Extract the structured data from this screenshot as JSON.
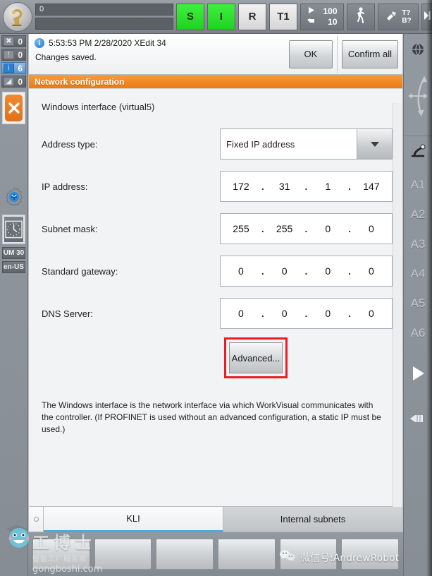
{
  "toolbar": {
    "robot_icon": "robot-arm-icon",
    "field_top_value": "0",
    "field_bottom_value": "",
    "buttons": [
      {
        "label": "S",
        "state": "green"
      },
      {
        "label": "I",
        "state": "green"
      },
      {
        "label": "R",
        "state": "pale"
      },
      {
        "label": "T1",
        "state": "pale"
      }
    ],
    "speed": {
      "program_override": "100",
      "jog_override": "10",
      "play-icon": "play-icon",
      "hand-icon": "jog-hand-icon"
    },
    "walk_icon": "walking-person-icon",
    "tool_base": {
      "tool": "T?",
      "base": "B?",
      "icon": "tool-icon"
    },
    "increment": {
      "icon": "increment-step-icon",
      "label": "∞"
    }
  },
  "left_rail": {
    "counters": [
      {
        "icon": "error-icon",
        "count": "0",
        "active": false
      },
      {
        "icon": "warning-icon",
        "count": "0",
        "active": false
      },
      {
        "icon": "information-icon",
        "count": "6",
        "active": true
      },
      {
        "icon": "note-icon",
        "count": "0",
        "active": false
      }
    ],
    "close_button": "close-x-icon",
    "network_icon": "network-settings-icon",
    "clock_icon": "clock-icon",
    "tags": [
      "UM 30",
      "en-US"
    ]
  },
  "right_rail": {
    "globe_icon": "world-coordinate-icon",
    "motion_icon": "motion-arc-icon",
    "axis_icon": "axis-jog-icon",
    "axes": [
      "A1",
      "A2",
      "A3",
      "A4",
      "A5",
      "A6"
    ],
    "play_icon": "play-triangle-icon",
    "hand_icon": "hand-jog-icon"
  },
  "message": {
    "icon": "information-icon",
    "header": "5:53:53 PM 2/28/2020 XEdit 34",
    "body": "Changes saved.",
    "ok_label": "OK",
    "confirm_all_label": "Confirm all"
  },
  "panel": {
    "title": "Network configuration",
    "interface_title": "Windows interface (virtual5)",
    "fields": [
      {
        "label": "Address type:",
        "type": "combo",
        "value": "Fixed IP address"
      },
      {
        "label": "IP address:",
        "type": "ip",
        "octets": [
          "172",
          "31",
          "1",
          "147"
        ]
      },
      {
        "label": "Subnet mask:",
        "type": "ip",
        "octets": [
          "255",
          "255",
          "0",
          "0"
        ]
      },
      {
        "label": "Standard gateway:",
        "type": "ip",
        "octets": [
          "0",
          "0",
          "0",
          "0"
        ]
      },
      {
        "label": "DNS Server:",
        "type": "ip",
        "octets": [
          "0",
          "0",
          "0",
          "0"
        ]
      }
    ],
    "advanced_label": "Advanced...",
    "advanced_highlight_color": "#ec1c24",
    "help_text": "The Windows interface is the network interface via which WorkVisual communicates with the controller. (If PROFINET is used without an advanced configuration, a static IP must be used.)"
  },
  "tabs": [
    {
      "label": "KLI",
      "active": true
    },
    {
      "label": "Internal subnets",
      "active": false
    }
  ],
  "bottom_buttons": [
    "",
    "",
    "",
    "",
    "",
    ""
  ],
  "watermarks": {
    "gongboshi_cn": "工博士",
    "gongboshi_sub": "智能工厂服务商",
    "gongboshi_url": "gongboshi.com",
    "wechat": "微信号:AndrewRobot"
  },
  "colors": {
    "accent_orange": "#ec7a12",
    "status_green": "#2ad02a",
    "info_blue": "#2f7fd0",
    "highlight_red": "#ec1c24",
    "tab_underline": "#4ba8e0"
  }
}
